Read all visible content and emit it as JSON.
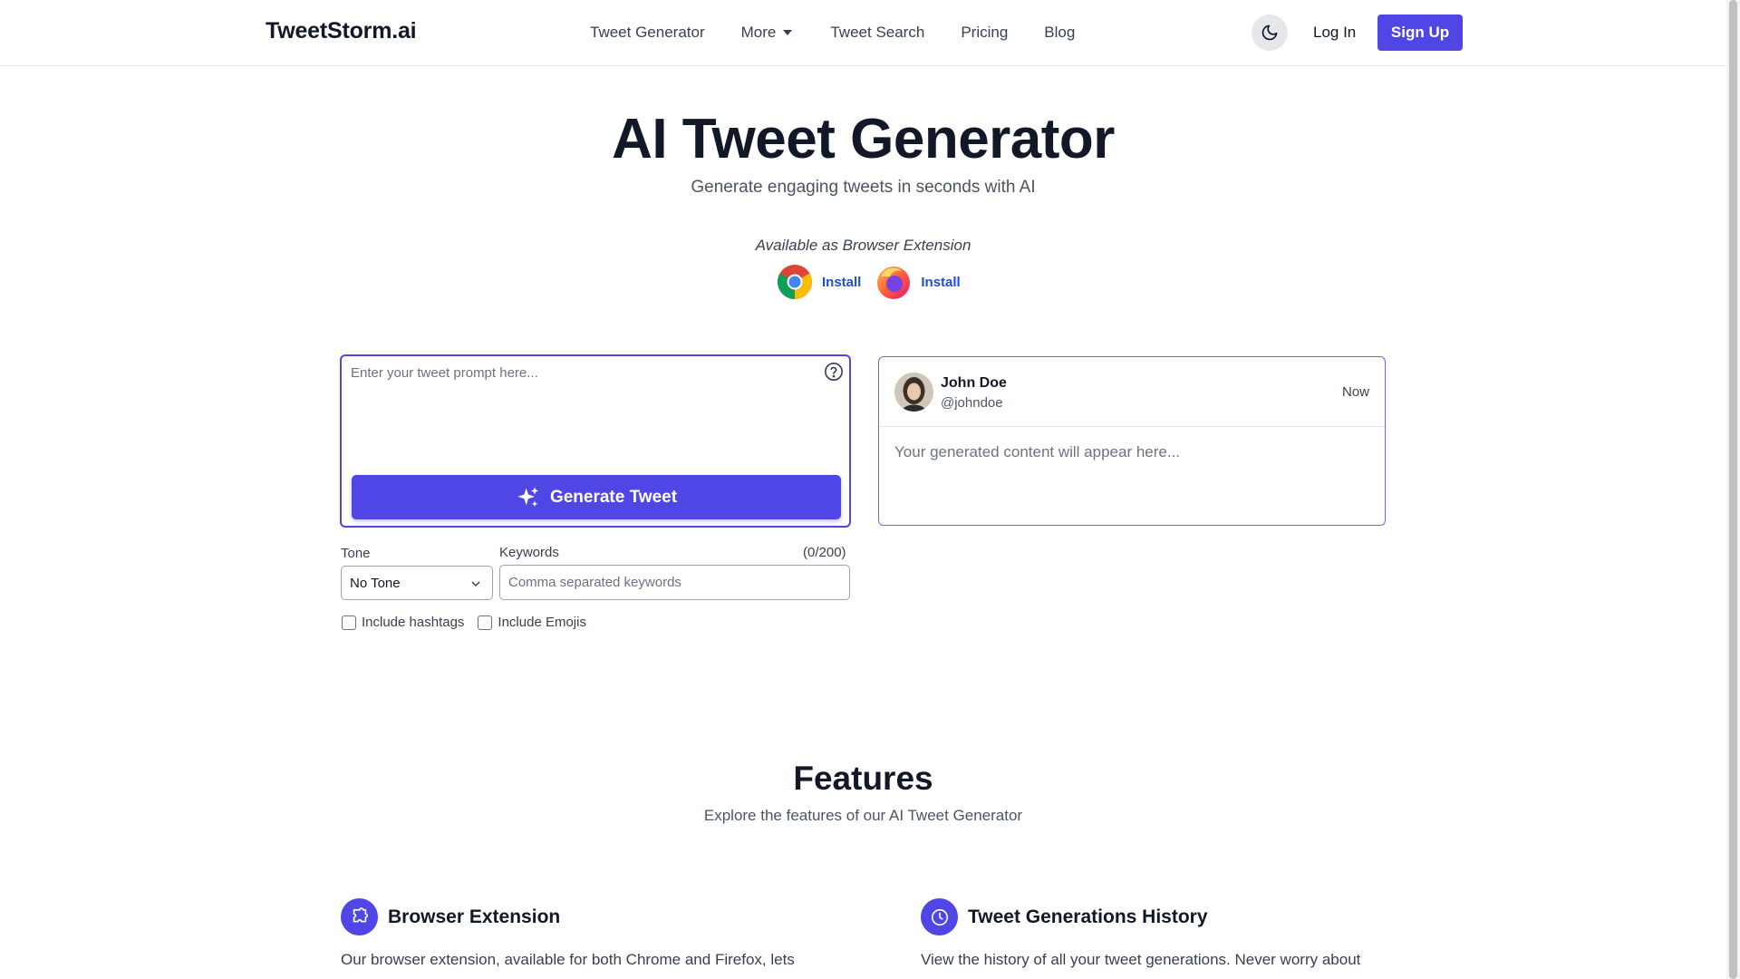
{
  "header": {
    "logo": "TweetStorm.ai",
    "nav": [
      "Tweet Generator",
      "More",
      "Tweet Search",
      "Pricing",
      "Blog"
    ],
    "login_label": "Log In",
    "signup_label": "Sign Up"
  },
  "hero": {
    "title": "AI Tweet Generator",
    "subtitle": "Generate engaging tweets in seconds with AI",
    "extension_label": "Available as Browser Extension",
    "extensions": [
      {
        "browser": "chrome-icon",
        "label": "Install"
      },
      {
        "browser": "firefox-icon",
        "label": "Install"
      }
    ]
  },
  "generator": {
    "prompt_placeholder": "Enter your tweet prompt here...",
    "generate_label": "Generate Tweet",
    "tone_label": "Tone",
    "tone_value": "No Tone",
    "keywords_label": "Keywords",
    "keywords_count": "(0/200)",
    "keywords_placeholder": "Comma separated keywords",
    "hashtags_label": "Include hashtags",
    "emojis_label": "Include Emojis"
  },
  "preview": {
    "name": "John Doe",
    "handle": "@johndoe",
    "time": "Now",
    "body": "Your generated content will appear here..."
  },
  "features": {
    "title": "Features",
    "subtitle": "Explore the features of our AI Tweet Generator",
    "items": [
      {
        "icon": "puzzle-icon",
        "name": "Browser Extension",
        "desc": "Our browser extension, available for both Chrome and Firefox, lets"
      },
      {
        "icon": "clock-icon",
        "name": "Tweet Generations History",
        "desc": "View the history of all your tweet generations. Never worry about"
      }
    ]
  },
  "colors": {
    "accent": "#4f46e5",
    "link": "#1d4ed8"
  }
}
